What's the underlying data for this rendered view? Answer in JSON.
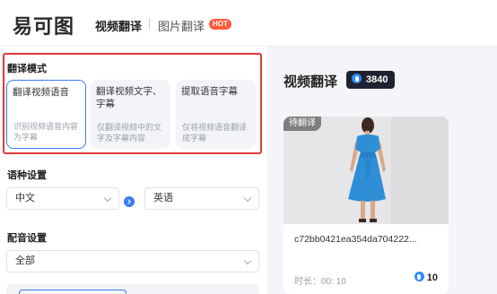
{
  "header": {
    "logo": "易可图",
    "nav_video": "视频翻译",
    "nav_image": "图片翻译",
    "hot": "HOT"
  },
  "left": {
    "mode_title": "翻译模式",
    "modes": [
      {
        "title": "翻译视频语音",
        "desc": "识别视频语音内容为字幕"
      },
      {
        "title": "翻译视频文字、字幕",
        "desc": "仅翻译视频中的文字及字幕内容"
      },
      {
        "title": "提取语音字幕",
        "desc": "仅将视频语音翻译成字幕"
      }
    ],
    "lang_label": "语种设置",
    "source_lang": "中文",
    "target_lang": "英语",
    "dub_label": "配音设置",
    "dub_value": "全部"
  },
  "right": {
    "title": "视频翻译",
    "points": "3840",
    "card": {
      "tag": "待翻译",
      "filename": "c72bb0421ea354da704222...",
      "duration": "时长：00: 10",
      "cost": "10"
    }
  },
  "colors": {
    "accent": "#3c7bf5",
    "highlight_border": "#e23b3b",
    "hot": "#ff5a3c",
    "dress": "#2f8fd6"
  }
}
